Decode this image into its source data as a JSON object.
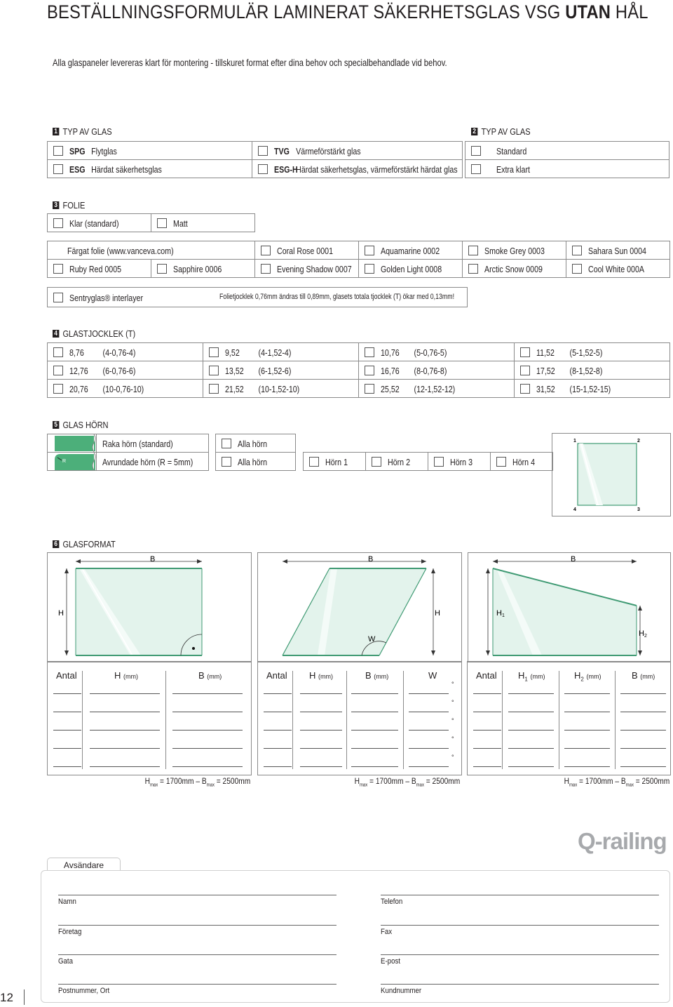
{
  "header": {
    "title_pre": "BESTÄLLNINGSFORMULÄR LAMINERAT SÄKERHETSGLAS VSG ",
    "title_bold": "UTAN",
    "title_post": " HÅL",
    "intro": "Alla glaspaneler levereras klart för montering - tillskuret format efter dina behov och specialbehandlade vid behov."
  },
  "section1": {
    "number": "1",
    "title": "TYP AV GLAS",
    "options": [
      {
        "code": "SPG",
        "label": "Flytglas"
      },
      {
        "code": "TVG",
        "label": "Värmeförstärkt glas"
      },
      {
        "code": "ESG",
        "label": "Härdat säkerhetsglas"
      },
      {
        "code": "ESG-H",
        "label": "Härdat säkerhetsglas, värmeförstärkt härdat glas"
      }
    ]
  },
  "section2": {
    "number": "2",
    "title": "TYP AV GLAS",
    "options": [
      "Standard",
      "Extra klart"
    ]
  },
  "section3": {
    "number": "3",
    "title": "FOLIE",
    "basic": [
      "Klar (standard)",
      "Matt"
    ],
    "colored_label": "Färgat folie (www.vanceva.com)",
    "colors": [
      "Coral Rose  0001",
      "Aquamarine  0002",
      "Smoke Grey  0003",
      "Sahara Sun  0004",
      "Ruby Red  0005",
      "Sapphire  0006",
      "Evening Shadow  0007",
      "Golden Light  0008",
      "Arctic Snow  0009",
      "Cool White  000A"
    ],
    "sentry_label": "Sentryglas® interlayer",
    "sentry_note": "Folietjocklek 0,76mm ändras till 0,89mm, glasets totala tjocklek (T) ökar med 0,13mm!"
  },
  "section4": {
    "number": "4",
    "title": "GLASTJOCKLEK (T)",
    "options": [
      {
        "t": "8,76",
        "build": "(4-0,76-4)"
      },
      {
        "t": "9,52",
        "build": "(4-1,52-4)"
      },
      {
        "t": "10,76",
        "build": "(5-0,76-5)"
      },
      {
        "t": "11,52",
        "build": "(5-1,52-5)"
      },
      {
        "t": "12,76",
        "build": "(6-0,76-6)"
      },
      {
        "t": "13,52",
        "build": "(6-1,52-6)"
      },
      {
        "t": "16,76",
        "build": "(8-0,76-8)"
      },
      {
        "t": "17,52",
        "build": "(8-1,52-8)"
      },
      {
        "t": "20,76",
        "build": "(10-0,76-10)"
      },
      {
        "t": "21,52",
        "build": "(10-1,52-10)"
      },
      {
        "t": "25,52",
        "build": "(12-1,52-12)"
      },
      {
        "t": "31,52",
        "build": "(15-1,52-15)"
      }
    ]
  },
  "section5": {
    "number": "5",
    "title": "GLAS HÖRN",
    "straight_label": "Raka hörn (standard)",
    "rounded_label": "Avrundade hörn (R = 5mm)",
    "all_corners": "Alla hörn",
    "corners": [
      "Hörn 1",
      "Hörn 2",
      "Hörn 3",
      "Hörn 4"
    ],
    "diagram_labels": [
      "1",
      "2",
      "3",
      "4"
    ],
    "radius_mark": "R"
  },
  "section6": {
    "number": "6",
    "title": "GLASFORMAT",
    "fig_labels": {
      "b": "B",
      "h": "H",
      "w": "W",
      "h1": "H",
      "h1_sub": "1",
      "h2": "H",
      "h2_sub": "2"
    },
    "tables": [
      {
        "cols": [
          {
            "t": "Antal"
          },
          {
            "t": "H",
            "unit": "(mm)"
          },
          {
            "t": "B",
            "unit": "(mm)"
          }
        ]
      },
      {
        "cols": [
          {
            "t": "Antal"
          },
          {
            "t": "H",
            "unit": "(mm)"
          },
          {
            "t": "B",
            "unit": "(mm)"
          },
          {
            "t": "W"
          }
        ]
      },
      {
        "cols": [
          {
            "t": "Antal"
          },
          {
            "t": "H",
            "sub": "1",
            "unit": "(mm)"
          },
          {
            "t": "H",
            "sub": "2",
            "unit": "(mm)"
          },
          {
            "t": "B",
            "unit": "(mm)"
          }
        ]
      }
    ],
    "degree": "°",
    "limits": {
      "h": "H",
      "h_sub": "max",
      "h_val": " = 1700mm  –  ",
      "b": "B",
      "b_sub": "max",
      "b_val": " = 2500mm"
    }
  },
  "logo": "Q-railing",
  "sender": {
    "tab": "Avsändare",
    "left": [
      "Namn",
      "Företag",
      "Gata",
      "Postnummer, Ort"
    ],
    "right": [
      "Telefon",
      "Fax",
      "E-post",
      "Kundnummer"
    ]
  },
  "page_number": "12",
  "colors": {
    "glass_fill": "#e3f3ec",
    "glass_edge": "#3f9a73",
    "corner_green": "#4caf7a"
  }
}
